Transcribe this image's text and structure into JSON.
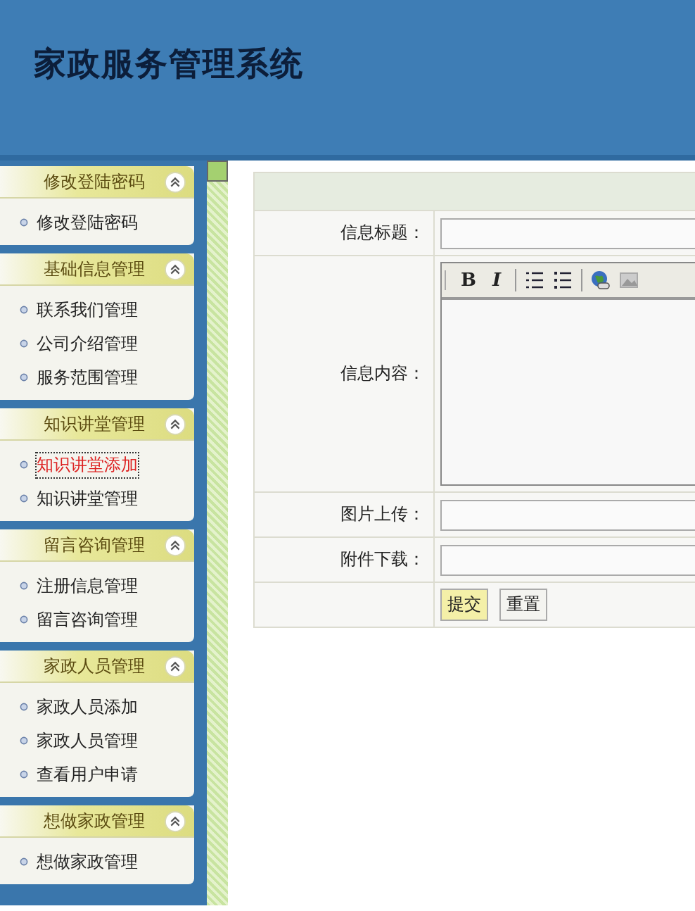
{
  "header": {
    "title": "家政服务管理系统"
  },
  "sidebar": {
    "groups": [
      {
        "title": "修改登陆密码",
        "expanded": true,
        "items": [
          {
            "label": "修改登陆密码",
            "selected": false
          }
        ]
      },
      {
        "title": "基础信息管理",
        "expanded": true,
        "items": [
          {
            "label": "联系我们管理",
            "selected": false
          },
          {
            "label": "公司介绍管理",
            "selected": false
          },
          {
            "label": "服务范围管理",
            "selected": false
          }
        ]
      },
      {
        "title": "知识讲堂管理",
        "expanded": true,
        "items": [
          {
            "label": "知识讲堂添加",
            "selected": true
          },
          {
            "label": "知识讲堂管理",
            "selected": false
          }
        ]
      },
      {
        "title": "留言咨询管理",
        "expanded": true,
        "items": [
          {
            "label": "注册信息管理",
            "selected": false
          },
          {
            "label": "留言咨询管理",
            "selected": false
          }
        ]
      },
      {
        "title": "家政人员管理",
        "expanded": true,
        "items": [
          {
            "label": "家政人员添加",
            "selected": false
          },
          {
            "label": "家政人员管理",
            "selected": false
          },
          {
            "label": "查看用户申请",
            "selected": false
          }
        ]
      },
      {
        "title": "想做家政管理",
        "expanded": true,
        "items": [
          {
            "label": "想做家政管理",
            "selected": false
          }
        ]
      }
    ]
  },
  "form": {
    "rows": [
      {
        "kind": "input",
        "label": "信息标题："
      },
      {
        "kind": "editor",
        "label": "信息内容：",
        "toolbar": [
          {
            "kind": "text",
            "label": "B"
          },
          {
            "kind": "italic",
            "label": "I"
          },
          {
            "kind": "ordered-list"
          },
          {
            "kind": "bullet-list"
          },
          {
            "kind": "globe"
          },
          {
            "kind": "image"
          }
        ]
      },
      {
        "kind": "input",
        "label": "图片上传："
      },
      {
        "kind": "input",
        "label": "附件下载："
      },
      {
        "kind": "buttons",
        "label": "",
        "buttons": [
          {
            "label": "提交",
            "selected": true
          },
          {
            "label": "重置",
            "selected": false
          }
        ]
      }
    ]
  }
}
